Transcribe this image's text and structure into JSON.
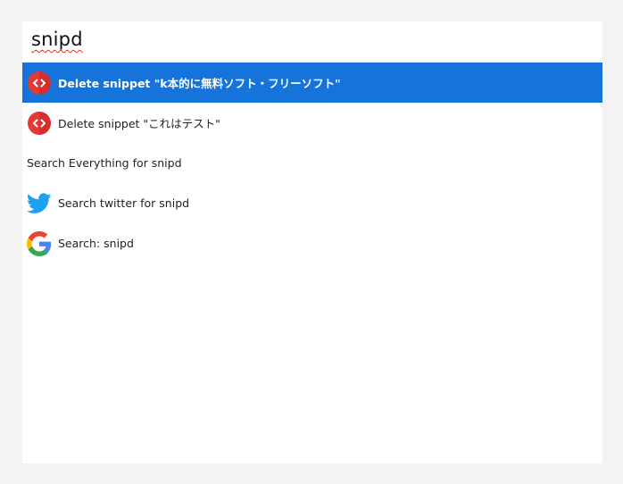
{
  "search": {
    "query": "snipd"
  },
  "results": [
    {
      "label": "Delete snippet \"k本的に無料ソフト・フリーソフト\"",
      "icon": "code-snippet-icon",
      "selected": true
    },
    {
      "label": "Delete snippet \"これはテスト\"",
      "icon": "code-snippet-icon",
      "selected": false
    },
    {
      "label": "Search Everything for snipd",
      "icon": "",
      "selected": false
    },
    {
      "label": "Search twitter for snipd",
      "icon": "twitter-icon",
      "selected": false
    },
    {
      "label": "Search: snipd",
      "icon": "google-icon",
      "selected": false
    }
  ],
  "colors": {
    "selected_bg": "#1673d9",
    "snippet_icon": "#e53935",
    "twitter": "#1da1f2"
  }
}
